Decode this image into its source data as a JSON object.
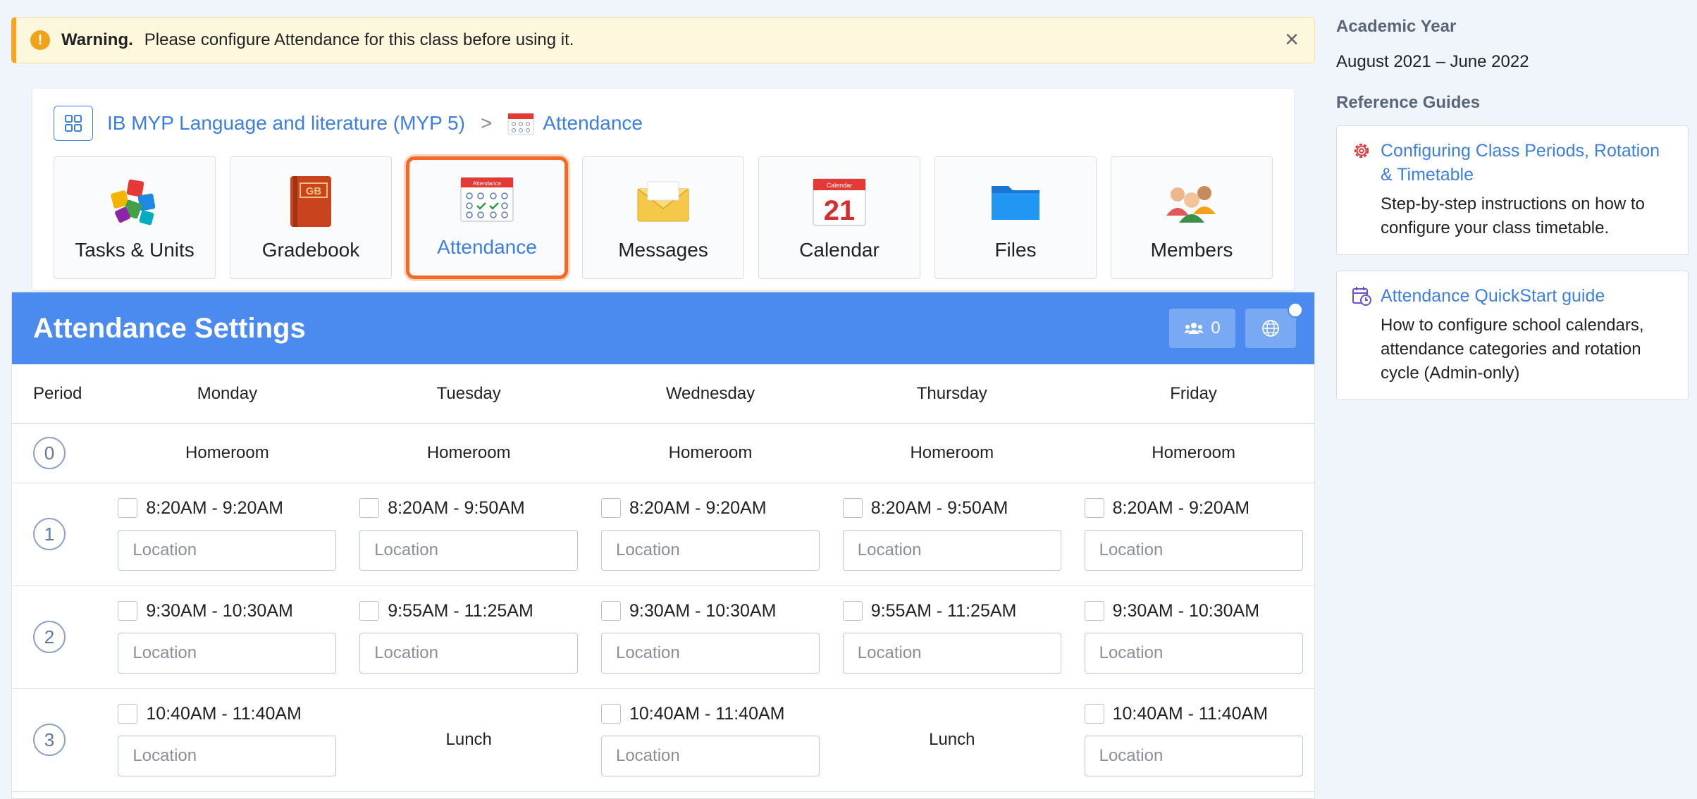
{
  "warning": {
    "title": "Warning.",
    "message": "Please configure Attendance for this class before using it."
  },
  "breadcrumb": {
    "class_name": "IB MYP Language and literature (MYP 5)",
    "separator": ">",
    "current": "Attendance"
  },
  "tiles": [
    {
      "label": "Tasks & Units",
      "icon": "puzzle-icon"
    },
    {
      "label": "Gradebook",
      "icon": "gradebook-icon",
      "badge": "GB"
    },
    {
      "label": "Attendance",
      "icon": "attendance-icon",
      "badge": "Attendance"
    },
    {
      "label": "Messages",
      "icon": "envelope-icon"
    },
    {
      "label": "Calendar",
      "icon": "calendar-icon",
      "badge": "Calendar",
      "day": "21"
    },
    {
      "label": "Files",
      "icon": "folder-icon"
    },
    {
      "label": "Members",
      "icon": "members-icon"
    }
  ],
  "settings": {
    "title": "Attendance Settings",
    "member_count": "0",
    "columns": [
      "Period",
      "Monday",
      "Tuesday",
      "Wednesday",
      "Thursday",
      "Friday"
    ],
    "homeroom": {
      "period": "0",
      "label": "Homeroom"
    },
    "location_placeholder": "Location",
    "periods": [
      {
        "number": "1",
        "slots": [
          "8:20AM - 9:20AM",
          "8:20AM - 9:50AM",
          "8:20AM - 9:20AM",
          "8:20AM - 9:50AM",
          "8:20AM - 9:20AM"
        ]
      },
      {
        "number": "2",
        "slots": [
          "9:30AM - 10:30AM",
          "9:55AM - 11:25AM",
          "9:30AM - 10:30AM",
          "9:55AM - 11:25AM",
          "9:30AM - 10:30AM"
        ]
      },
      {
        "number": "3",
        "slots": [
          "10:40AM - 11:40AM",
          "Lunch",
          "10:40AM - 11:40AM",
          "Lunch",
          "10:40AM - 11:40AM"
        ]
      }
    ]
  },
  "sidebar": {
    "academic_year_heading": "Academic Year",
    "academic_year_value": "August 2021 – June 2022",
    "reference_heading": "Reference Guides",
    "guides": [
      {
        "title": "Configuring Class Periods, Rotation & Timetable",
        "description": "Step-by-step instructions on how to configure your class timetable.",
        "icon": "gear-icon"
      },
      {
        "title": "Attendance QuickStart guide",
        "description": "How to configure school calendars, attendance categories and rotation cycle (Admin-only)",
        "icon": "calendar-clock-icon"
      }
    ]
  },
  "colors": {
    "accent": "#3d7fe0",
    "header": "#4b8bf0",
    "highlight": "#f26a24",
    "warning": "#f5a623"
  }
}
